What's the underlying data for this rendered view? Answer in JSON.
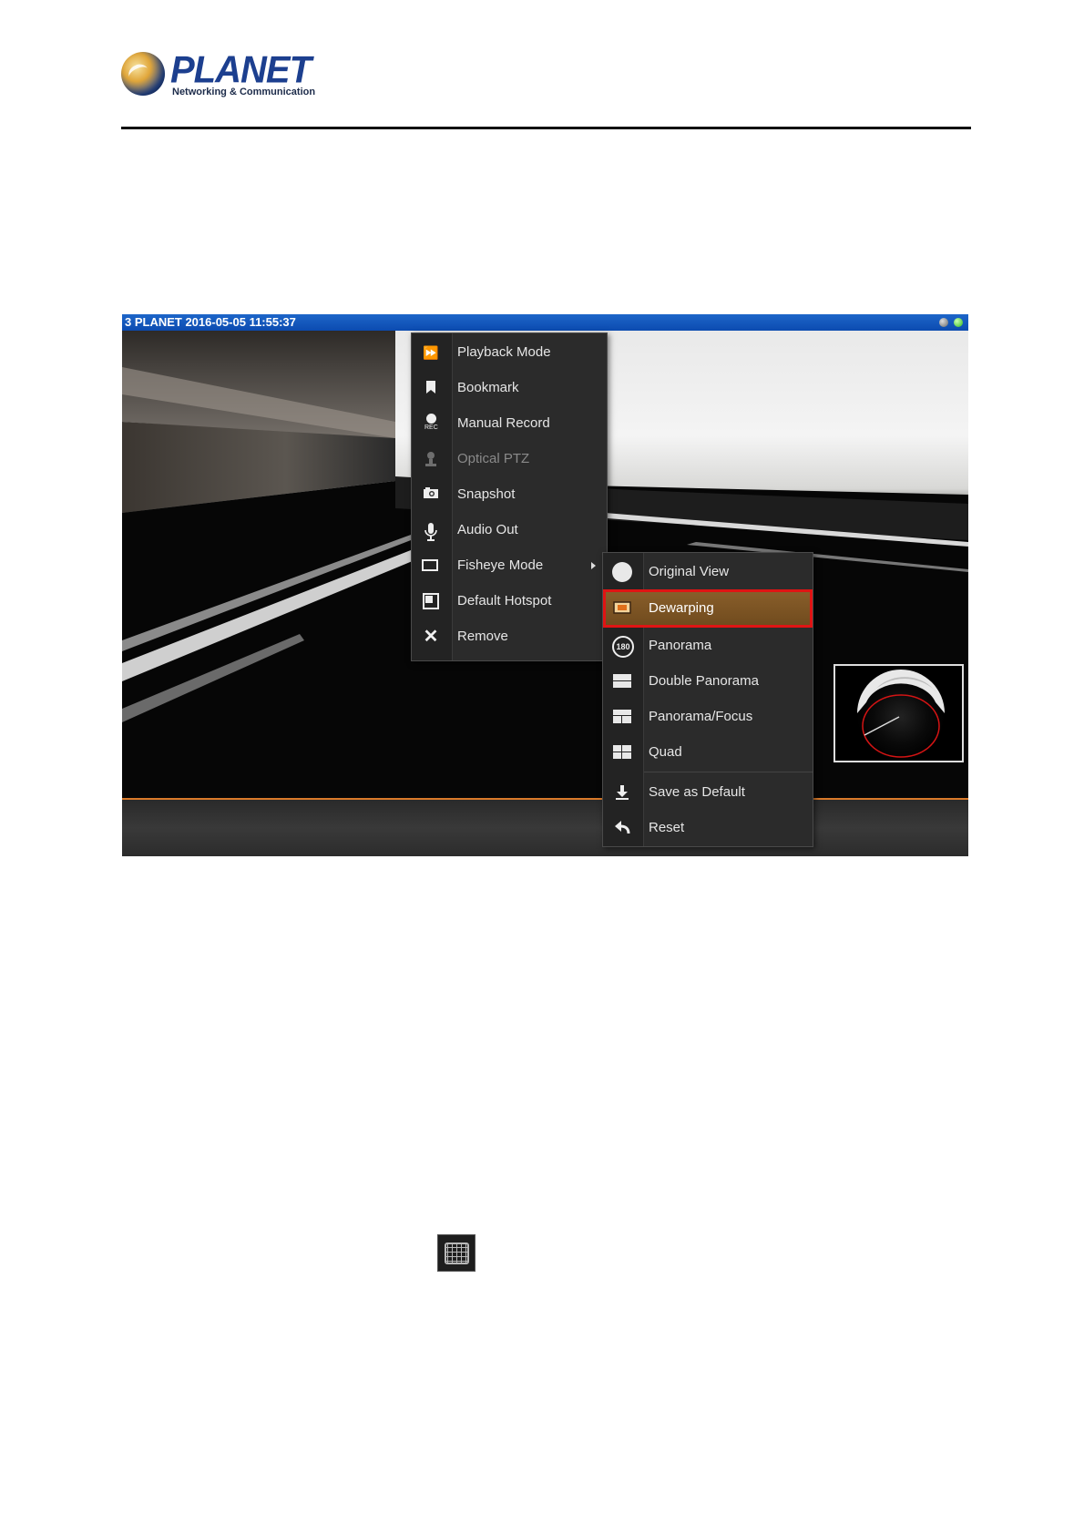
{
  "logo": {
    "brand": "PLANET",
    "tagline": "Networking & Communication"
  },
  "window": {
    "title": "3 PLANET   2016-05-05 11:55:37"
  },
  "context_menu": {
    "items": [
      {
        "label": "Playback Mode",
        "icon": "fast-forward-icon",
        "enabled": true
      },
      {
        "label": "Bookmark",
        "icon": "bookmark-icon",
        "enabled": true
      },
      {
        "label": "Manual Record",
        "icon": "rec-icon",
        "enabled": true
      },
      {
        "label": "Optical PTZ",
        "icon": "ptz-icon",
        "enabled": false
      },
      {
        "label": "Snapshot",
        "icon": "camera-icon",
        "enabled": true
      },
      {
        "label": "Audio Out",
        "icon": "microphone-icon",
        "enabled": true
      },
      {
        "label": "Fisheye Mode",
        "icon": "fisheye-icon",
        "enabled": true,
        "has_submenu": true
      },
      {
        "label": "Default Hotspot",
        "icon": "hotspot-icon",
        "enabled": true
      },
      {
        "label": "Remove",
        "icon": "close-icon",
        "enabled": true
      }
    ],
    "rec_text": "REC"
  },
  "fisheye_submenu": {
    "items": [
      {
        "label": "Original View",
        "icon": "circle-icon"
      },
      {
        "label": "Dewarping",
        "icon": "dewarp-icon",
        "selected": true
      },
      {
        "label": "Panorama",
        "icon": "panorama-180-icon",
        "icon_text": "180"
      },
      {
        "label": "Double Panorama",
        "icon": "double-panorama-icon"
      },
      {
        "label": "Panorama/Focus",
        "icon": "panorama-focus-icon"
      },
      {
        "label": "Quad",
        "icon": "quad-icon"
      },
      {
        "label": "Save as Default",
        "icon": "download-icon"
      },
      {
        "label": "Reset",
        "icon": "undo-icon"
      }
    ]
  },
  "colors": {
    "titlebar": "#0c4bb0",
    "highlight": "#8a5f2b",
    "highlight_border": "#e01414",
    "footer_accent": "#d97a2a"
  }
}
